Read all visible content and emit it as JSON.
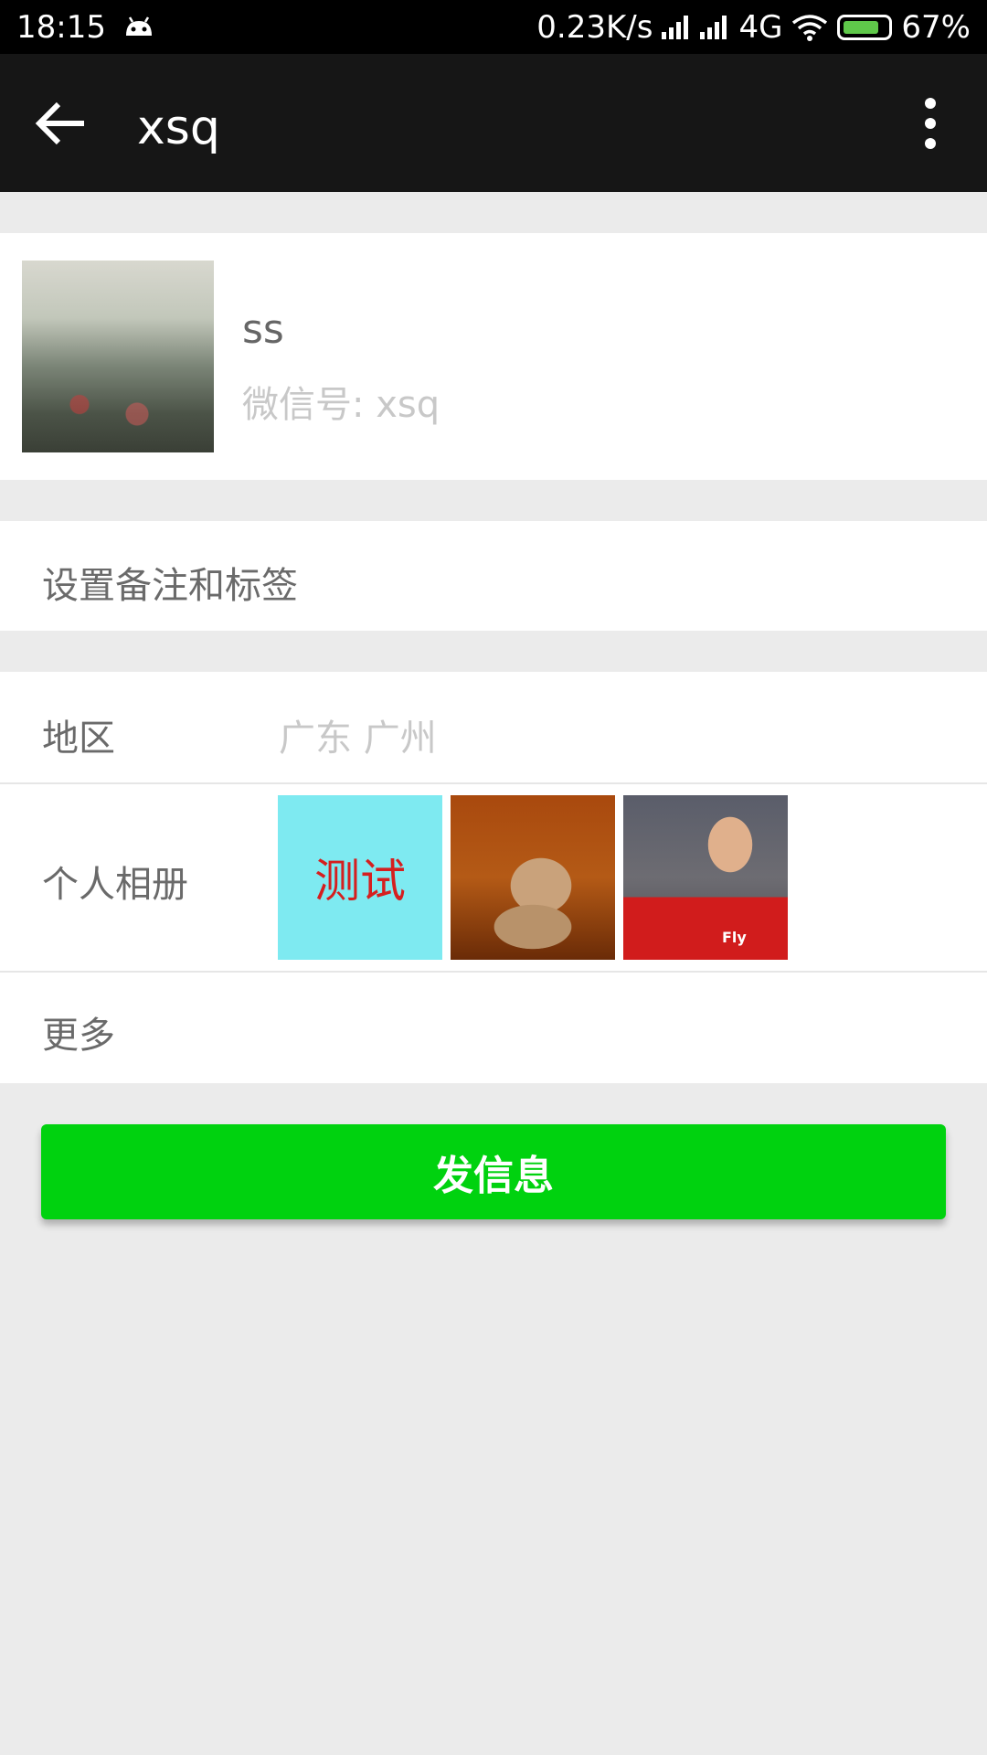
{
  "status_bar": {
    "time": "18:15",
    "net_speed": "0.23K/s",
    "network_type": "4G",
    "battery": "67%",
    "icons": [
      "android-icon",
      "signal-icon",
      "signal-icon",
      "wifi-icon",
      "battery-charging-icon"
    ]
  },
  "toolbar": {
    "title": "xsq",
    "back_icon": "arrow-left-icon",
    "more_icon": "vertical-dots-icon"
  },
  "profile": {
    "name": "ss",
    "wechat_id": "微信号: xsq"
  },
  "remark": {
    "label": "设置备注和标签"
  },
  "info": {
    "region_label": "地区",
    "region_value": "广东  广州",
    "album_label": "个人相册",
    "album_thumbs": [
      {
        "caption": "测试",
        "bg": "#7eeaf1",
        "color": "#d51f1f"
      },
      {
        "caption": ""
      },
      {
        "caption": "",
        "jersey": "Fly"
      }
    ],
    "more_label": "更多"
  },
  "actions": {
    "send_message": "发信息"
  },
  "colors": {
    "accent": "#00d20f",
    "toolbar": "#161616",
    "background": "#ebebeb"
  }
}
